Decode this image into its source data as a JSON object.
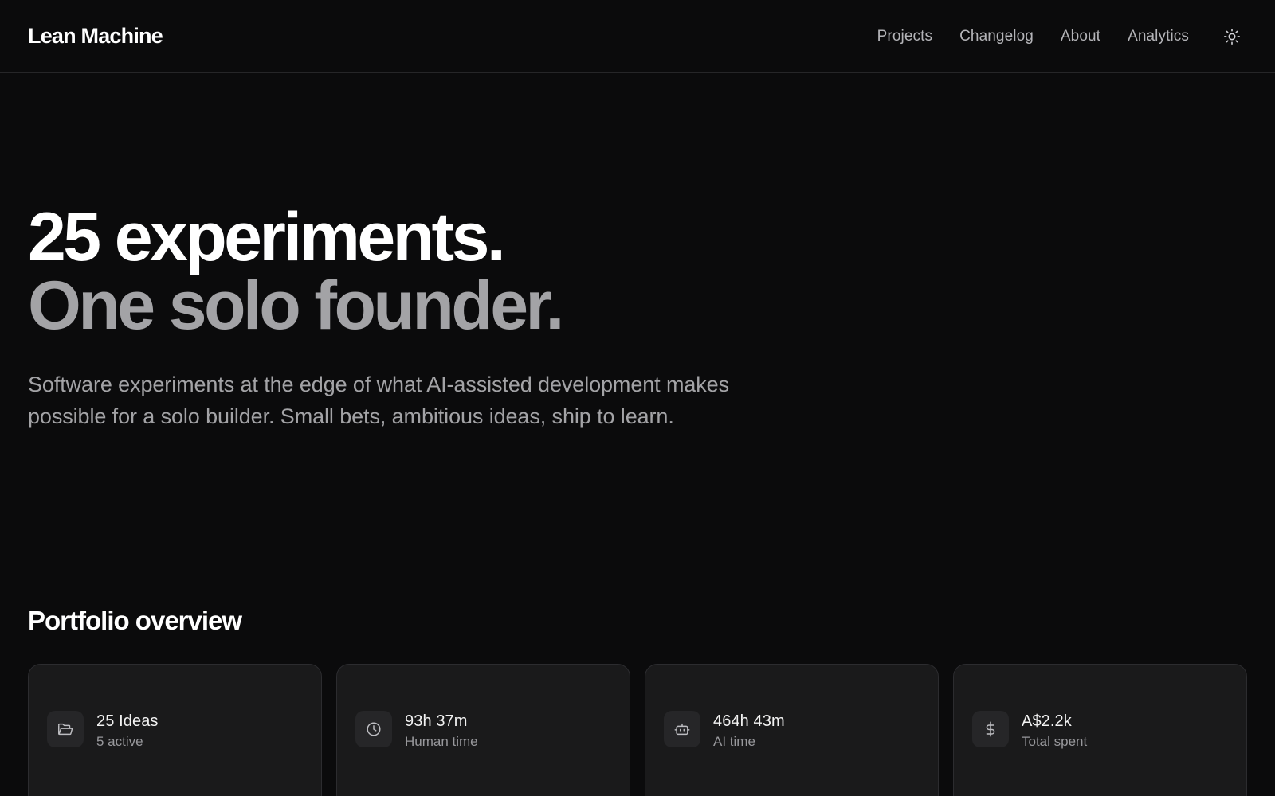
{
  "header": {
    "brand": "Lean Machine",
    "nav": [
      "Projects",
      "Changelog",
      "About",
      "Analytics"
    ],
    "theme_toggle_icon": "sun-icon"
  },
  "hero": {
    "line1": "25 experiments.",
    "line2": "One solo founder.",
    "subtitle": "Software experiments at the edge of what AI-assisted development makes possible for a solo builder. Small bets, ambitious ideas, ship to learn."
  },
  "overview": {
    "title": "Portfolio overview",
    "cards": [
      {
        "icon": "folder-open-icon",
        "value": "25 Ideas",
        "label": "5 active"
      },
      {
        "icon": "clock-icon",
        "value": "93h 37m",
        "label": "Human time"
      },
      {
        "icon": "bot-icon",
        "value": "464h 43m",
        "label": "AI time"
      },
      {
        "icon": "dollar-icon",
        "value": "A$2.2k",
        "label": "Total spent"
      }
    ]
  },
  "colors": {
    "background": "#0b0b0c",
    "card_background": "#1a1a1b",
    "border": "#262628",
    "text_primary": "#ffffff",
    "text_muted": "#a3a3a6"
  }
}
